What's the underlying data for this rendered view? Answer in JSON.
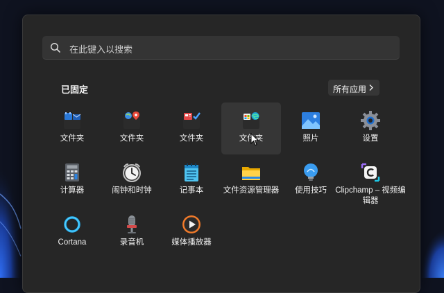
{
  "search": {
    "placeholder": "在此键入以搜索"
  },
  "pinned": {
    "title": "已固定",
    "all_apps_label": "所有应用",
    "apps": [
      {
        "label": "文件夹",
        "icon": "folder-outlook-icon"
      },
      {
        "label": "文件夹",
        "icon": "folder-maps-icon"
      },
      {
        "label": "文件夹",
        "icon": "folder-news-icon"
      },
      {
        "label": "文件夹",
        "icon": "folder-store-edge-icon"
      },
      {
        "label": "照片",
        "icon": "photos-icon"
      },
      {
        "label": "设置",
        "icon": "settings-gear-icon"
      },
      {
        "label": "计算器",
        "icon": "calculator-icon"
      },
      {
        "label": "闹钟和时钟",
        "icon": "alarm-clock-icon"
      },
      {
        "label": "记事本",
        "icon": "notepad-icon"
      },
      {
        "label": "文件资源管理器",
        "icon": "file-explorer-icon"
      },
      {
        "label": "使用技巧",
        "icon": "tips-lightbulb-icon"
      },
      {
        "label": "Clipchamp – 视频编辑器",
        "icon": "clipchamp-icon"
      },
      {
        "label": "Cortana",
        "icon": "cortana-icon"
      },
      {
        "label": "录音机",
        "icon": "microphone-icon"
      },
      {
        "label": "媒体播放器",
        "icon": "media-player-icon"
      }
    ]
  },
  "colors": {
    "menu_bg": "#262626",
    "search_bg": "#343434",
    "hover_bg": "#363636",
    "accent_blue": "#1e7fe0"
  }
}
